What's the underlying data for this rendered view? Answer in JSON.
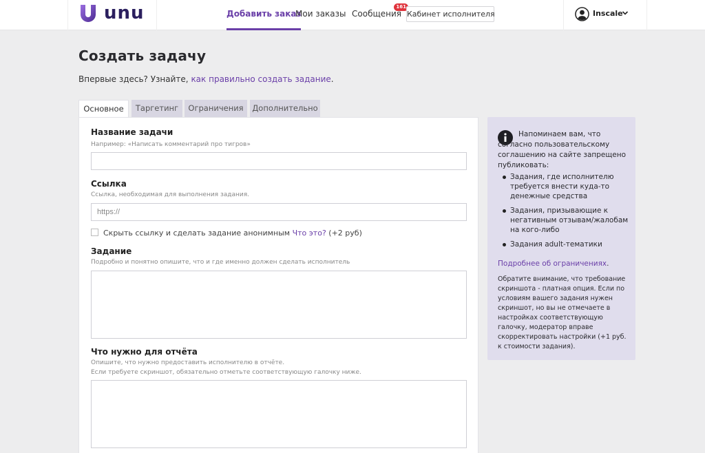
{
  "brand": {
    "name": "unu"
  },
  "nav": {
    "add_order": "Добавить заказ",
    "my_orders": "Мои заказы",
    "messages": "Сообщения",
    "messages_badge": "161",
    "cabinet": "Кабинет исполнителя"
  },
  "user": {
    "name": "Inscale"
  },
  "page": {
    "title": "Создать задачу",
    "intro_prefix": "Впервые здесь? Узнайте, ",
    "intro_link": "как правильно создать задание",
    "intro_suffix": "."
  },
  "tabs": [
    {
      "label": "Основное",
      "active": true
    },
    {
      "label": "Таргетинг",
      "active": false
    },
    {
      "label": "Ограничения",
      "active": false
    },
    {
      "label": "Дополнительно",
      "active": false
    }
  ],
  "form": {
    "task_name": {
      "label": "Название задачи",
      "hint": "Например: «Написать комментарий про тигров»",
      "value": ""
    },
    "link": {
      "label": "Ссылка",
      "hint": "Ссылка, необходимая для выполнения задания.",
      "placeholder": "https://",
      "value": ""
    },
    "anonymous": {
      "label": "Скрыть ссылку и сделать задание анонимным",
      "link": "Что это?",
      "price": "(+2 руб)",
      "checked": false
    },
    "task": {
      "label": "Задание",
      "hint": "Подробно и понятно опишите, что и где именно должен сделать исполнитель",
      "value": ""
    },
    "report": {
      "label": "Что нужно для отчёта",
      "hint_1": "Опишите, что нужно предоставить исполнителю в отчёте.",
      "hint_2": "Если требуете скриншот, обязательно отметьте соответствующую галочку ниже.",
      "value": ""
    }
  },
  "info": {
    "text": "Напоминаем вам, что согласно пользовательскому соглашению на сайте запрещено публиковать:",
    "rules": [
      "Задания, где исполнителю требуется внести куда-то денежные средства",
      "Задания, призывающие к негативным отзывам/жалобам на кого-либо",
      "Задания adult-тематики"
    ],
    "more_link": "Подробнее об ограничениях",
    "more_suffix": ".",
    "note": "Обратите внимание, что требование скриншота - платная опция. Если по условиям вашего задания нужен скриншот, но вы не отмечаете в настройках соответствующую галочку, модератор вправе скорректировать настройки (+1 руб. к стоимости задания)."
  },
  "colors": {
    "accent": "#6a3fa8",
    "badge": "#e0333c",
    "info_bg": "#e0dded",
    "page_bg": "#ededee",
    "tab_bg": "#d8d6e2"
  }
}
